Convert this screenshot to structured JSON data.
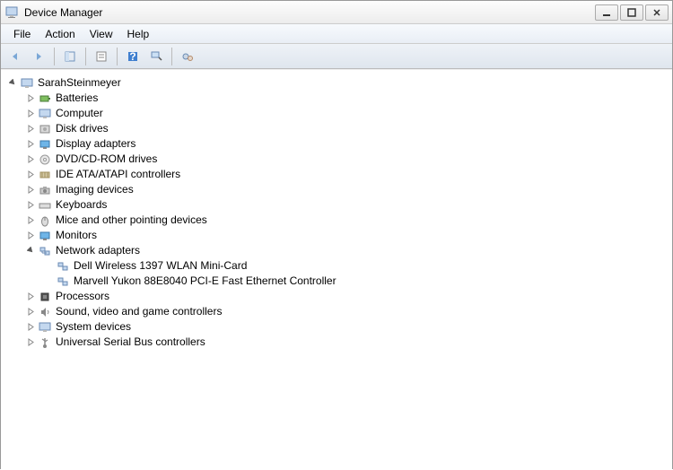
{
  "window": {
    "title": "Device Manager"
  },
  "menu": {
    "file": "File",
    "action": "Action",
    "view": "View",
    "help": "Help"
  },
  "tree": {
    "root": "SarahSteinmeyer",
    "batteries": "Batteries",
    "computer": "Computer",
    "disk_drives": "Disk drives",
    "display_adapters": "Display adapters",
    "dvd_cd": "DVD/CD-ROM drives",
    "ide": "IDE ATA/ATAPI controllers",
    "imaging": "Imaging devices",
    "keyboards": "Keyboards",
    "mice": "Mice and other pointing devices",
    "monitors": "Monitors",
    "network": "Network adapters",
    "network_wlan": "Dell Wireless 1397 WLAN Mini-Card",
    "network_eth": "Marvell Yukon 88E8040 PCI-E Fast Ethernet Controller",
    "processors": "Processors",
    "sound": "Sound, video and game controllers",
    "system": "System devices",
    "usb": "Universal Serial Bus controllers"
  }
}
